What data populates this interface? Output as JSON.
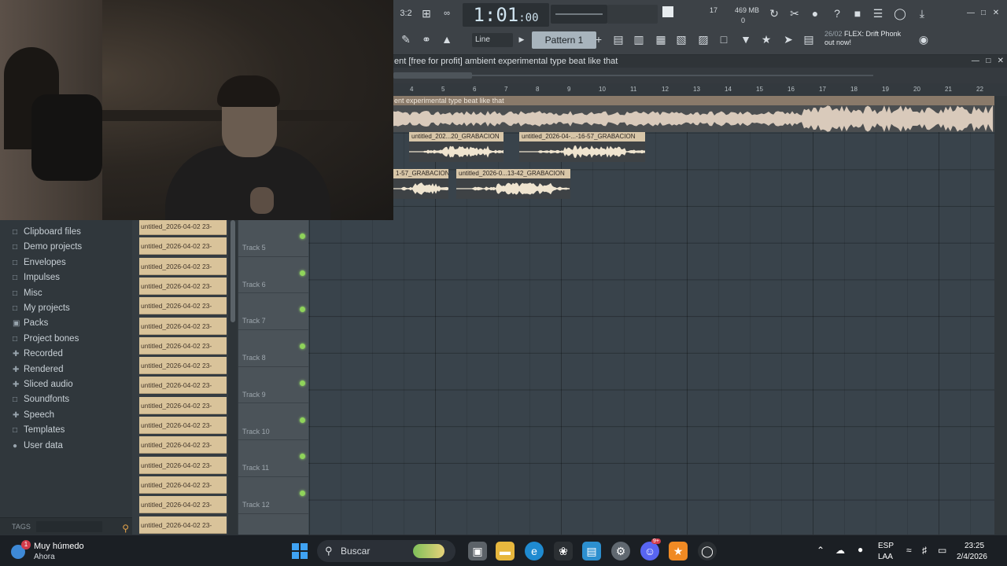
{
  "transport": {
    "time_main": "1:01",
    "time_sub": ":00",
    "voices": "17",
    "memory": "469 MB",
    "cpu": "0"
  },
  "toolbar": {
    "snap_mode": "Line",
    "pattern": "Pattern 1",
    "news_date": "26/02",
    "news_text": "FLEX: Drift Phonk out now!"
  },
  "playlist": {
    "title": "ent  [free for profit] ambient  experimental type beat like that",
    "bar_numbers": [
      "4",
      "5",
      "6",
      "7",
      "8",
      "9",
      "10",
      "11",
      "12",
      "13",
      "14",
      "15",
      "16",
      "17",
      "18",
      "19",
      "20",
      "21",
      "22"
    ],
    "main_clip": "ent  experimental type beat like that",
    "clips": [
      {
        "label": "untitled_202...20_GRABACION"
      },
      {
        "label": "untitled_2026-04-...-16-57_GRABACION"
      },
      {
        "label": "1-57_GRABACION"
      },
      {
        "label": "untitled_2026-0...13-42_GRABACION"
      }
    ],
    "tracks": [
      "Track 5",
      "Track 6",
      "Track 7",
      "Track 8",
      "Track 9",
      "Track 10",
      "Track 11",
      "Track 12"
    ]
  },
  "browser": {
    "items": [
      {
        "icon": "folder-icon",
        "label": "Clipboard files"
      },
      {
        "icon": "folder-icon",
        "label": "Demo projects"
      },
      {
        "icon": "folder-icon",
        "label": "Envelopes"
      },
      {
        "icon": "folder-icon",
        "label": "Impulses"
      },
      {
        "icon": "folder-icon",
        "label": "Misc"
      },
      {
        "icon": "folder-icon",
        "label": "My projects"
      },
      {
        "icon": "packs-icon",
        "label": "Packs"
      },
      {
        "icon": "folder-icon",
        "label": "Project bones"
      },
      {
        "icon": "plus-icon",
        "label": "Recorded"
      },
      {
        "icon": "plus-icon",
        "label": "Rendered"
      },
      {
        "icon": "plus-icon",
        "label": "Sliced audio"
      },
      {
        "icon": "folder-icon",
        "label": "Soundfonts"
      },
      {
        "icon": "plus-icon",
        "label": "Speech"
      },
      {
        "icon": "folder-icon",
        "label": "Templates"
      },
      {
        "icon": "user-icon",
        "label": "User data"
      }
    ],
    "tags_label": "TAGS",
    "files": [
      "untitled_2026-04-02 23-",
      "untitled_2026-04-02 23-",
      "untitled_2026-04-02 23-",
      "untitled_2026-04-02 23-",
      "untitled_2026-04-02 23-",
      "untitled_2026-04-02 23-",
      "untitled_2026-04-02 23-",
      "untitled_2026-04-02 23-",
      "untitled_2026-04-02 23-",
      "untitled_2026-04-02 23-",
      "untitled_2026-04-02 23-",
      "untitled_2026-04-02 23-",
      "untitled_2026-04-02 23-",
      "untitled_2026-04-02 23-",
      "untitled_2026-04-02 23-",
      "untitled_2026-04-02 23-"
    ]
  },
  "taskbar": {
    "weather_badge": "1",
    "weather_title": "Muy húmedo",
    "weather_sub": "Ahora",
    "search_placeholder": "Buscar",
    "discord_badge": "9+",
    "lang1": "ESP",
    "lang2": "LAA",
    "time": "23:25",
    "date": "2/4/2026"
  }
}
